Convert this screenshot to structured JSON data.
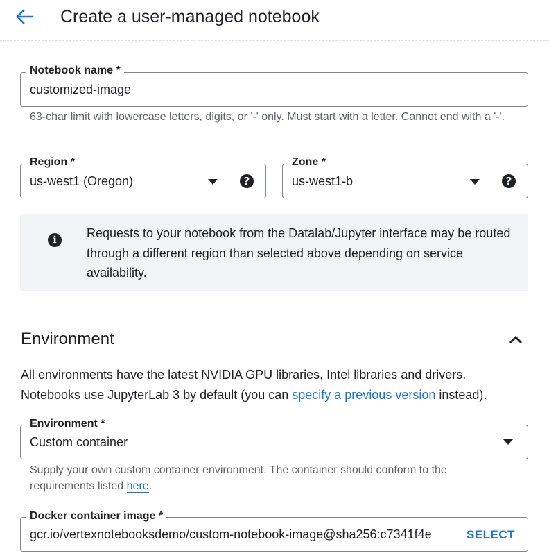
{
  "header": {
    "back_icon": "arrow-back-icon",
    "title": "Create a user-managed notebook"
  },
  "notebook_name": {
    "label": "Notebook name *",
    "value": "customized-image",
    "hint": "63-char limit with lowercase letters, digits, or '-' only. Must start with a letter. Cannot end with a '-'."
  },
  "region": {
    "label": "Region *",
    "value": "us-west1 (Oregon)"
  },
  "zone": {
    "label": "Zone *",
    "value": "us-west1-b"
  },
  "info_box": {
    "icon": "info-icon",
    "text": "Requests to your notebook from the Datalab/Jupyter interface may be routed through a different region than selected above depending on service availability."
  },
  "environment_section": {
    "title": "Environment",
    "collapse_icon": "chevron-up-icon",
    "desc_line1": "All environments have the latest NVIDIA GPU libraries, Intel libraries and drivers.",
    "desc_line2_prefix": "Notebooks use JupyterLab 3 by default (you can ",
    "desc_link": "specify a previous version",
    "desc_line2_suffix": " instead)."
  },
  "environment": {
    "label": "Environment *",
    "value": "Custom container",
    "hint_prefix": "Supply your own custom container environment. The container should conform to the requirements listed ",
    "hint_link": "here",
    "hint_suffix": "."
  },
  "docker_image": {
    "label": "Docker container image *",
    "value": "gcr.io/vertexnotebooksdemo/custom-notebook-image@sha256:c7341f4e",
    "select_label": "SELECT"
  },
  "colors": {
    "accent": "#1a73e8",
    "text": "#202124",
    "muted": "#5f6368",
    "border": "#80868b",
    "info_bg": "#f1f3f4"
  }
}
